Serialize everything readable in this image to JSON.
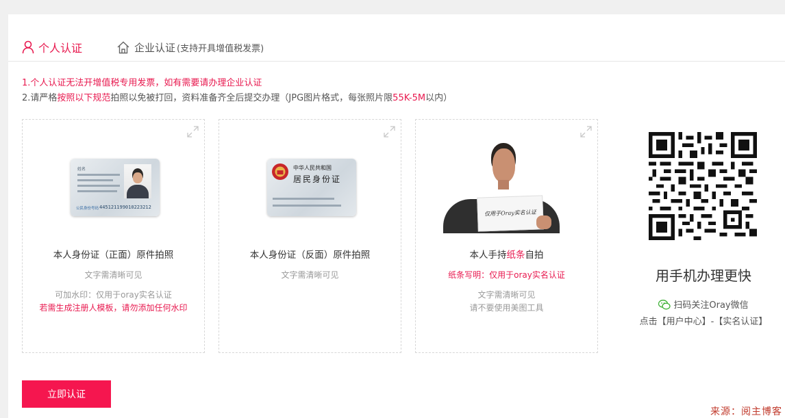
{
  "tabs": {
    "personal": "个人认证",
    "company": "企业认证",
    "company_sub": "(支持开具增值税发票)"
  },
  "notes": {
    "line1": "1.个人认证无法开增值税专用发票，如有需要请办理企业认证",
    "line2_a": "2.请严格",
    "line2_b": "按照以下规范",
    "line2_c": "拍照以免被打回，资料准备齐全后提交办理（JPG图片格式，每张照片限",
    "line2_d": "55K-5M",
    "line2_e": "以内）"
  },
  "cards": [
    {
      "title": "本人身份证（正面）原件拍照",
      "line1": "文字需清晰可见",
      "line2": "可加水印：仅用于oray实名认证",
      "line3": "若需生成注册人模板，请勿添加任何水印"
    },
    {
      "title": "本人身份证（反面）原件拍照",
      "line1": "文字需清晰可见"
    },
    {
      "title_a": "本人手持",
      "title_b": "纸条",
      "title_c": "自拍",
      "line1": "纸条写明：仅用于oray实名认证",
      "line2": "文字需清晰可见",
      "line3": "请不要使用美图工具"
    }
  ],
  "id_front": {
    "name_label": "姓名",
    "id_number": "445121199010223212",
    "id_label": "公民身份号码"
  },
  "id_back": {
    "country": "中华人民共和国",
    "doc": "居民身份证"
  },
  "selfie_note": "仅用于Oray实名认证",
  "qr": {
    "title": "用手机办理更快",
    "wechat": "扫码关注Oray微信",
    "path": "点击【用户中心】-【实名认证】"
  },
  "submit_label": "立即认证",
  "source_label": "来源：阅主博客",
  "colors": {
    "accent": "#e8194f",
    "button": "#f5164f"
  }
}
